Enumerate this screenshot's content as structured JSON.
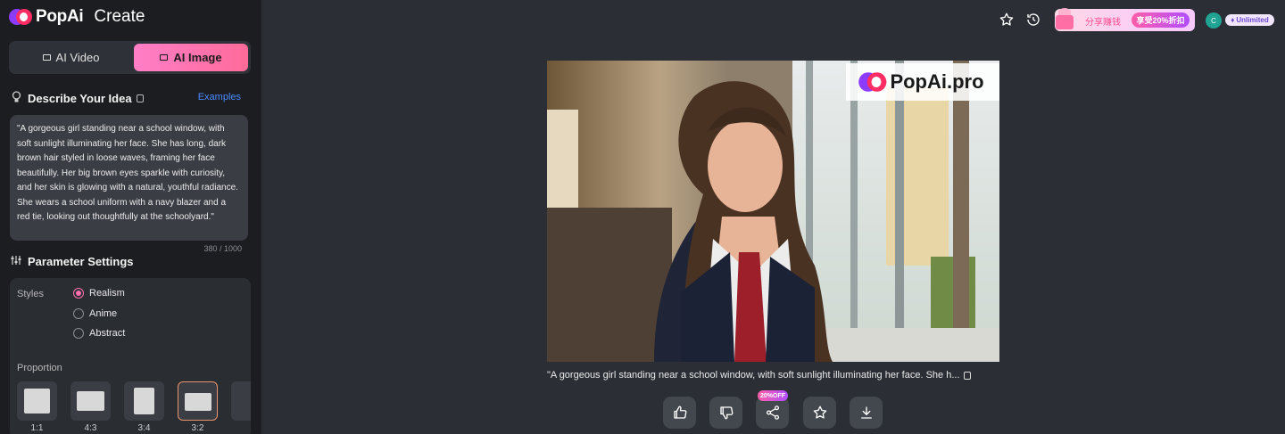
{
  "app": {
    "brand": "PopAi",
    "section": "Create"
  },
  "mode_tabs": {
    "video_label": "AI Video",
    "image_label": "AI Image",
    "active": "AI Image"
  },
  "describe": {
    "heading": "Describe Your Idea",
    "examples_label": "Examples",
    "prompt": "\"A gorgeous girl standing near a school window, with soft sunlight illuminating her face. She has long, dark brown hair styled in loose waves, framing her face beautifully. Her big brown eyes sparkle with curiosity, and her skin is glowing with a natural, youthful radiance. She wears a school uniform with a navy blazer and a red tie, looking out thoughtfully at the schoolyard.\"",
    "counter": "380 / 1000"
  },
  "params": {
    "heading": "Parameter Settings",
    "styles_label": "Styles",
    "styles": [
      {
        "label": "Realism",
        "selected": true
      },
      {
        "label": "Anime",
        "selected": false
      },
      {
        "label": "Abstract",
        "selected": false
      }
    ],
    "proportion_label": "Proportion",
    "ratios": [
      {
        "label": "1:1",
        "selected": false
      },
      {
        "label": "4:3",
        "selected": false
      },
      {
        "label": "3:4",
        "selected": false
      },
      {
        "label": "3:2",
        "selected": true
      }
    ]
  },
  "topbar": {
    "promo_text": "分享赚钱",
    "promo_pill": "享受20%折扣",
    "avatar_initial": "C",
    "plan_badge": "Unlimited"
  },
  "result": {
    "watermark": "PopAi.pro",
    "caption": "\"A gorgeous girl standing near a school window, with soft sunlight illuminating her face. She h...",
    "share_badge": "20%OFF"
  },
  "colors": {
    "accent_pink": "#ff6fb0",
    "link_blue": "#4b8bff",
    "sidebar_bg": "#1b1d21",
    "main_bg": "#2b2f35"
  }
}
